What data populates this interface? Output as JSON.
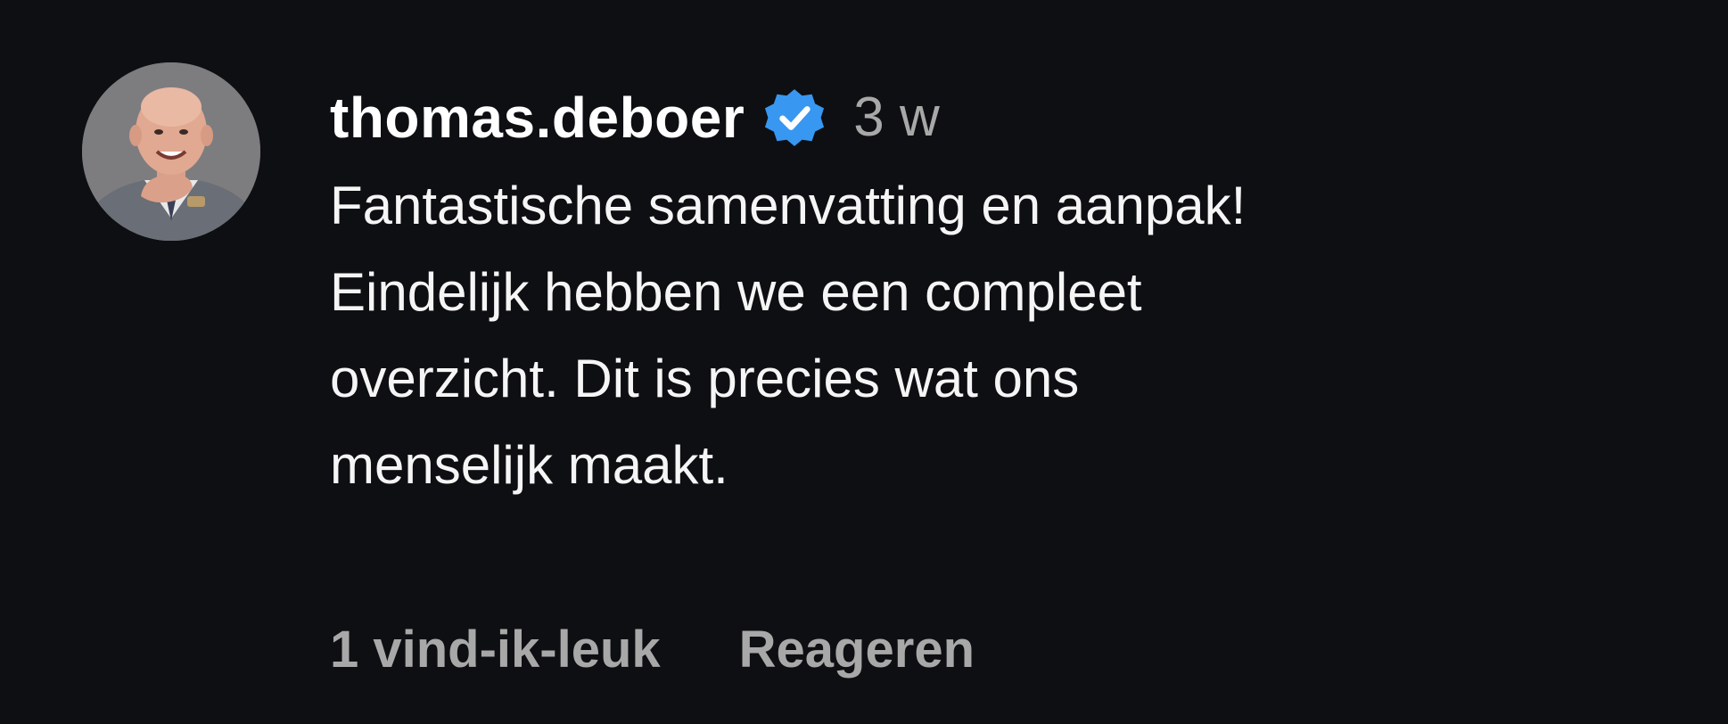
{
  "comment": {
    "avatar_icon": "profile-photo",
    "username": "thomas.deboer",
    "verified_icon": "verified-badge-icon",
    "verified_color": "#3897f0",
    "timestamp": "3 w",
    "text": "Fantastische samenvatting en aanpak!\nEindelijk hebben we een compleet\noverzicht. Dit is precies wat ons\nmenselijk maakt.",
    "likes_label": "1 vind-ik-leuk",
    "reply_label": "Reageren"
  },
  "colors": {
    "background": "#0e0f13",
    "primary_text": "#ffffff",
    "secondary_text": "#a8a8a8"
  }
}
